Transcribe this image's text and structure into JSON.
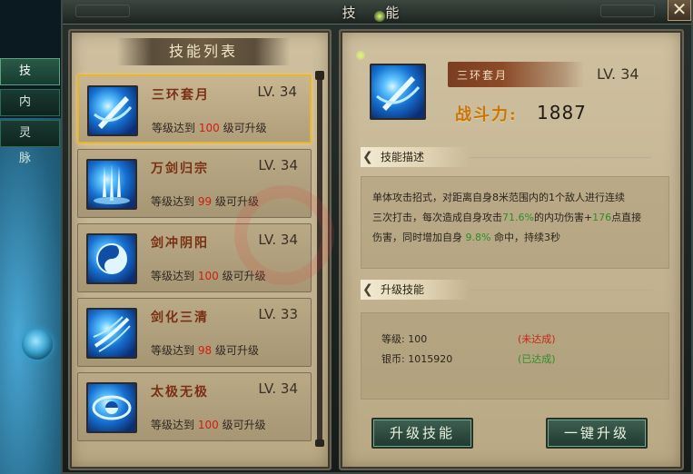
{
  "window": {
    "title": "技 能",
    "close_label": "✕"
  },
  "side_tabs": [
    {
      "label": "技能",
      "active": true
    },
    {
      "label": "内功",
      "active": false
    },
    {
      "label": "灵脉",
      "active": false
    }
  ],
  "skill_list": {
    "header": "技能列表",
    "items": [
      {
        "name": "三环套月",
        "level": "LV. 34",
        "req_prefix": "等级达到",
        "req_value": "100",
        "req_suffix": "级可升级",
        "selected": true,
        "icon": "sword-slash-icon"
      },
      {
        "name": "万剑归宗",
        "level": "LV. 34",
        "req_prefix": "等级达到",
        "req_value": "99",
        "req_suffix": "级可升级",
        "selected": false,
        "icon": "sword-rain-icon"
      },
      {
        "name": "剑冲阴阳",
        "level": "LV. 34",
        "req_prefix": "等级达到",
        "req_value": "100",
        "req_suffix": "级可升级",
        "selected": false,
        "icon": "yin-yang-icon"
      },
      {
        "name": "剑化三清",
        "level": "LV. 33",
        "req_prefix": "等级达到",
        "req_value": "98",
        "req_suffix": "级可升级",
        "selected": false,
        "icon": "triple-slash-icon"
      },
      {
        "name": "太极无极",
        "level": "LV. 34",
        "req_prefix": "等级达到",
        "req_value": "100",
        "req_suffix": "级可升级",
        "selected": false,
        "icon": "taiji-icon"
      }
    ]
  },
  "detail": {
    "name": "三环套月",
    "level": "LV. 34",
    "power_label": "战斗力:",
    "power_value": "1887",
    "desc_header": "技能描述",
    "desc_line1": "单体攻击招式，对距离自身8米范围内的1个敌人进行连续",
    "desc_line2a": "三次打击，每次造成自身攻击",
    "desc_pct1": "71.6%",
    "desc_line2b": "的内功伤害+",
    "desc_flat": "176",
    "desc_line2c": "点直接",
    "desc_line3a": "伤害，同时增加自身",
    "desc_pct2": "9.8%",
    "desc_line3b": "命中，持续3秒",
    "upgrade_header": "升级技能",
    "req_level_label": "等级: 100",
    "req_level_status": "(未达成)",
    "req_silver_label": "银币: 1015920",
    "req_silver_status": "(已达成)",
    "btn_upgrade": "升级技能",
    "btn_one_key": "一键升级"
  },
  "colors": {
    "accent_red": "#d21d10",
    "status_fail": "#c8261a",
    "status_ok": "#2b8f28",
    "gold": "#c7760d"
  }
}
